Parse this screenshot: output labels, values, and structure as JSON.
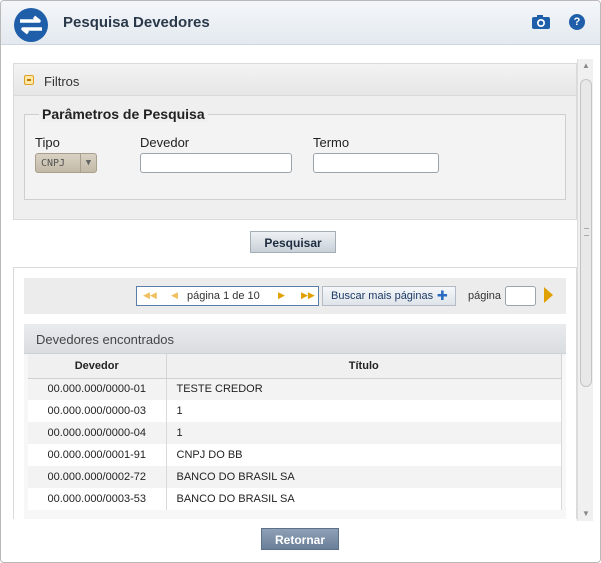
{
  "window": {
    "title": "Pesquisa Devedores"
  },
  "filters": {
    "section_label": "Filtros",
    "fieldset_legend": "Parâmetros de Pesquisa",
    "tipo_label": "Tipo",
    "tipo_value": "CNPJ",
    "devedor_label": "Devedor",
    "devedor_value": "",
    "termo_label": "Termo",
    "termo_value": ""
  },
  "buttons": {
    "pesquisar": "Pesquisar",
    "retornar": "Retornar",
    "buscar_mais": "Buscar mais páginas"
  },
  "pagination": {
    "text": "página 1 de 10",
    "current_page": 1,
    "total_pages": 10,
    "goto_label": "página",
    "goto_value": ""
  },
  "results": {
    "title": "Devedores encontrados",
    "columns": [
      "Devedor",
      "Título"
    ],
    "rows": [
      {
        "devedor": "00.000.000/0000-01",
        "titulo": "TESTE CREDOR"
      },
      {
        "devedor": "00.000.000/0000-03",
        "titulo": "1"
      },
      {
        "devedor": "00.000.000/0000-04",
        "titulo": "1"
      },
      {
        "devedor": "00.000.000/0001-91",
        "titulo": "CNPJ DO BB"
      },
      {
        "devedor": "00.000.000/0002-72",
        "titulo": "BANCO DO BRASIL SA"
      },
      {
        "devedor": "00.000.000/0003-53",
        "titulo": "BANCO DO BRASIL SA"
      }
    ]
  },
  "icons": {
    "logo": "siafi-logo-icon",
    "camera": "camera-icon",
    "help": "help-icon",
    "collapse": "collapse-minus-icon",
    "select_arrow": "dropdown-arrow-icon",
    "first": "first-page-icon",
    "prev": "previous-page-icon",
    "next": "next-page-icon",
    "last": "last-page-icon",
    "plus": "plus-icon",
    "go": "go-arrow-icon"
  },
  "colors": {
    "brand_blue": "#1f5ea8",
    "accent_orange": "#e0a000",
    "button_dark": "#6a7f98"
  }
}
